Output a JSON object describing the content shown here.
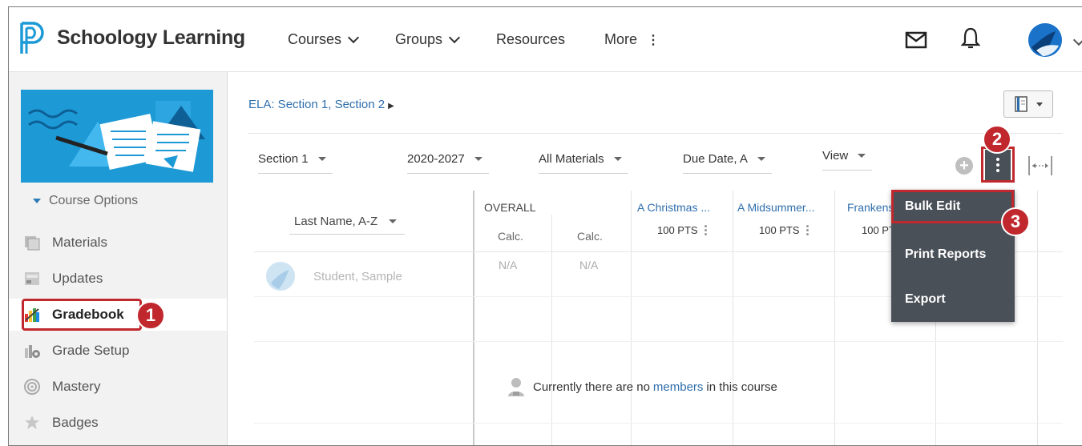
{
  "header": {
    "brand": "Schoology Learning",
    "nav": [
      {
        "label": "Courses"
      },
      {
        "label": "Groups"
      },
      {
        "label": "Resources"
      },
      {
        "label": "More"
      }
    ]
  },
  "sidebar": {
    "course_options": "Course Options",
    "items": [
      {
        "label": "Materials"
      },
      {
        "label": "Updates"
      },
      {
        "label": "Gradebook"
      },
      {
        "label": "Grade Setup"
      },
      {
        "label": "Mastery"
      },
      {
        "label": "Badges"
      }
    ]
  },
  "main": {
    "breadcrumb": "ELA: Section 1, Section 2",
    "filters": {
      "section": "Section 1",
      "year": "2020-2027",
      "materials": "All Materials",
      "sort": "Due Date, A",
      "view": "View"
    },
    "grid": {
      "sort_label": "Last Name, A-Z",
      "overall": "OVERALL",
      "calc1": "Calc.",
      "calc2": "Calc.",
      "columns": [
        {
          "title": "A Christmas ...",
          "pts": "100 PTS"
        },
        {
          "title": "A Midsummer...",
          "pts": "100 PTS"
        },
        {
          "title": "Frankens",
          "pts": "100 PT"
        }
      ],
      "student": "Student, Sample",
      "na1": "N/A",
      "na2": "N/A",
      "empty_prefix": "Currently there are no",
      "empty_link": "members",
      "empty_suffix": "in this course"
    }
  },
  "menu": {
    "items": [
      {
        "label": "Bulk Edit"
      },
      {
        "label": "Print Reports"
      },
      {
        "label": "Export"
      }
    ]
  },
  "callouts": {
    "one": "1",
    "two": "2",
    "three": "3"
  },
  "colors": {
    "brand_blue": "#1d9ad6",
    "link": "#2f6fad",
    "highlight_red": "#c0282e",
    "menu_bg": "#4a5057"
  },
  "icons": [
    "schoology-logo-icon",
    "mail-icon",
    "bell-icon",
    "avatar-icon",
    "notebook-icon",
    "plus-icon",
    "kebab-icon",
    "expand-columns-icon",
    "person-icon"
  ]
}
